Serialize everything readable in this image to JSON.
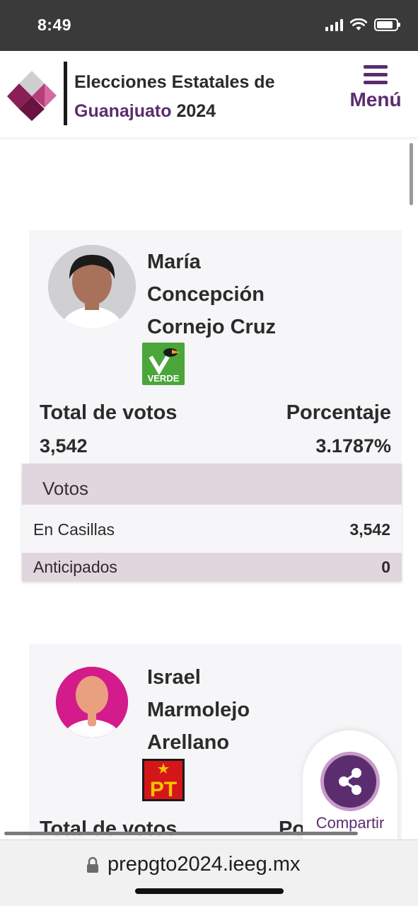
{
  "status_bar": {
    "time": "8:49"
  },
  "header": {
    "title_line1": "Elecciones Estatales de",
    "title_state": "Guanajuato",
    "title_year": "2024",
    "menu_label": "Menú"
  },
  "candidates": [
    {
      "name_lines": [
        "María",
        "Concepción",
        "Cornejo Cruz"
      ],
      "party": "VERDE",
      "total_votes_label": "Total de votos",
      "total_votes": "3,542",
      "percent_label": "Porcentaje",
      "percent": "3.1787%",
      "votes_table": {
        "header": "Votos",
        "rows": [
          {
            "label": "En Casillas",
            "value": "3,542"
          },
          {
            "label": "Anticipados",
            "value": "0"
          }
        ]
      }
    },
    {
      "name_lines": [
        "Israel",
        "Marmolejo",
        "Arellano"
      ],
      "party": "PT",
      "total_votes_label": "Total de votos",
      "percent_label_partial": "Po"
    }
  ],
  "share": {
    "label": "Compartir"
  },
  "browser": {
    "url": "prepgto2024.ieeg.mx"
  },
  "colors": {
    "brand_purple": "#5b2d6e",
    "table_header": "#e2d6de",
    "verde_green": "#4aa63a",
    "pt_red": "#d4161b"
  }
}
